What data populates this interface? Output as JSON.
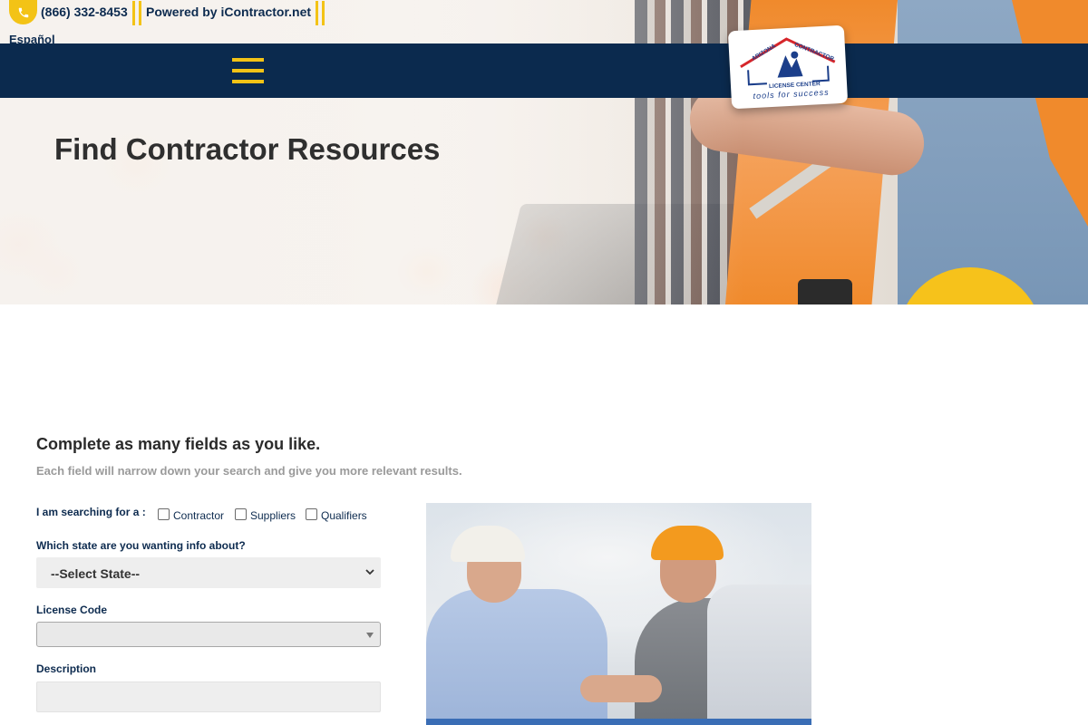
{
  "topbar": {
    "phone": "(866) 332-8453",
    "powered_by": "Powered by iContractor.net",
    "language_link": "Español"
  },
  "nav": {
    "menu_icon": "hamburger-menu-icon"
  },
  "logo": {
    "line1": "ARIZONA",
    "line2": "CONTRACTOR",
    "line3": "LICENSE CENTER",
    "tagline": "tools for success"
  },
  "hero": {
    "title": "Find Contractor Resources"
  },
  "form": {
    "heading": "Complete as many fields as you like.",
    "subheading": "Each field will narrow down your search and give you more relevant results.",
    "searching_label": "I am searching for a :",
    "options": [
      {
        "label": "Contractor",
        "checked": false
      },
      {
        "label": "Suppliers",
        "checked": false
      },
      {
        "label": "Qualifiers",
        "checked": false
      }
    ],
    "state_label": "Which state are you wanting info about?",
    "state_value": "--Select State--",
    "license_code_label": "License Code",
    "license_code_value": "",
    "description_label": "Description",
    "description_value": ""
  },
  "colors": {
    "navy": "#0b2a4e",
    "accent_yellow": "#f3c316",
    "text_dark": "#2f2f2f",
    "muted_text": "#9a9a9a"
  }
}
